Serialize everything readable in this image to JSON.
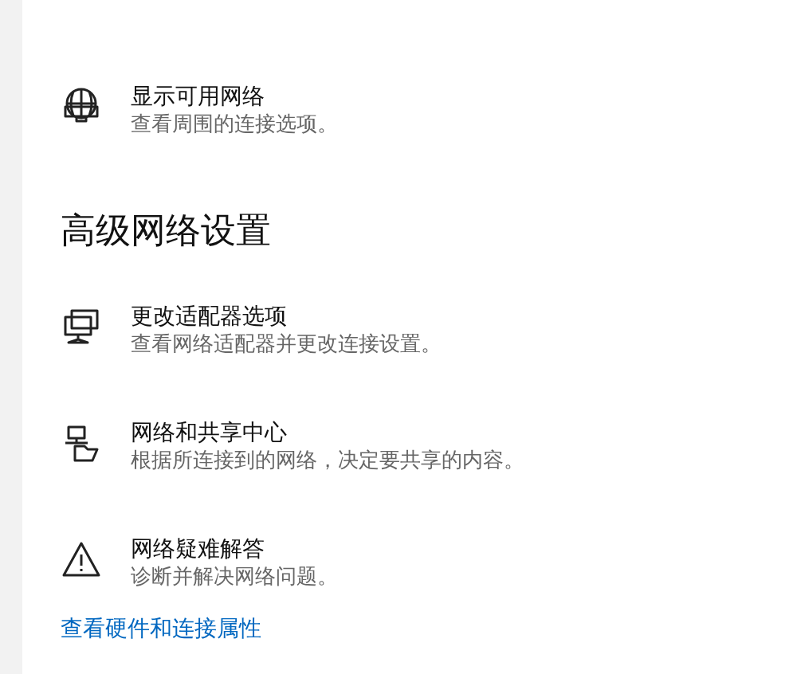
{
  "top_items": [
    {
      "kind": "globe",
      "title": "显示可用网络",
      "description": "查看周围的连接选项。"
    }
  ],
  "section": {
    "heading": "高级网络设置",
    "items": [
      {
        "kind": "monitor",
        "title": "更改适配器选项",
        "description": "查看网络适配器并更改连接设置。"
      },
      {
        "kind": "sharing",
        "title": "网络和共享中心",
        "description": "根据所连接到的网络，决定要共享的内容。"
      },
      {
        "kind": "warning",
        "title": "网络疑难解答",
        "description": "诊断并解决网络问题。"
      }
    ]
  },
  "link": "查看硬件和连接属性"
}
